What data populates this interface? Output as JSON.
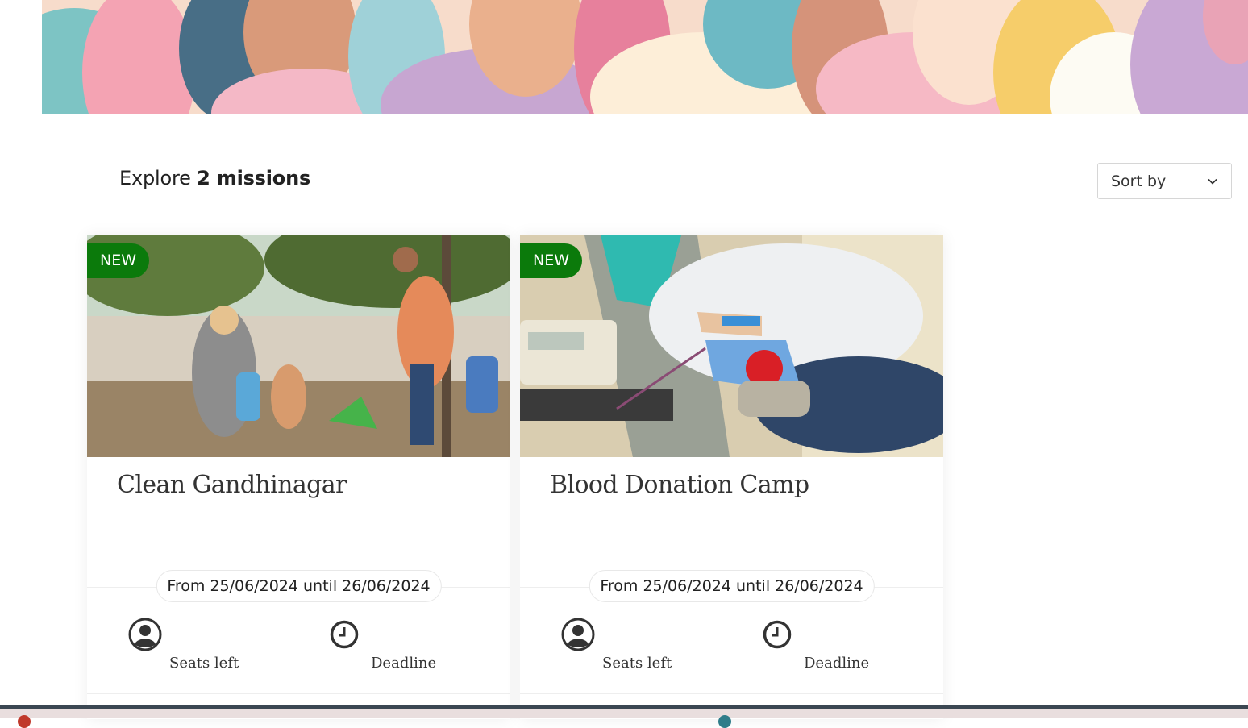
{
  "banner": {
    "icon": "people-illustration"
  },
  "header": {
    "explore_prefix": "Explore",
    "explore_count": "2 missions",
    "sort_label": "Sort by",
    "sort_icon": "chevron-down-icon"
  },
  "missions": [
    {
      "badge": "NEW",
      "title": "Clean Gandhinagar",
      "dates": "From 25/06/2024 until 26/06/2024",
      "seats_label": "Seats left",
      "deadline_label": "Deadline",
      "image": "volunteers-cleaning-park"
    },
    {
      "badge": "NEW",
      "title": "Blood Donation Camp",
      "dates": "From 25/06/2024 until 26/06/2024",
      "seats_label": "Seats left",
      "deadline_label": "Deadline",
      "image": "blood-donor-in-chair"
    }
  ],
  "colors": {
    "badge": "#0b7a0b",
    "text": "#222222",
    "border": "#d6d6d6"
  }
}
